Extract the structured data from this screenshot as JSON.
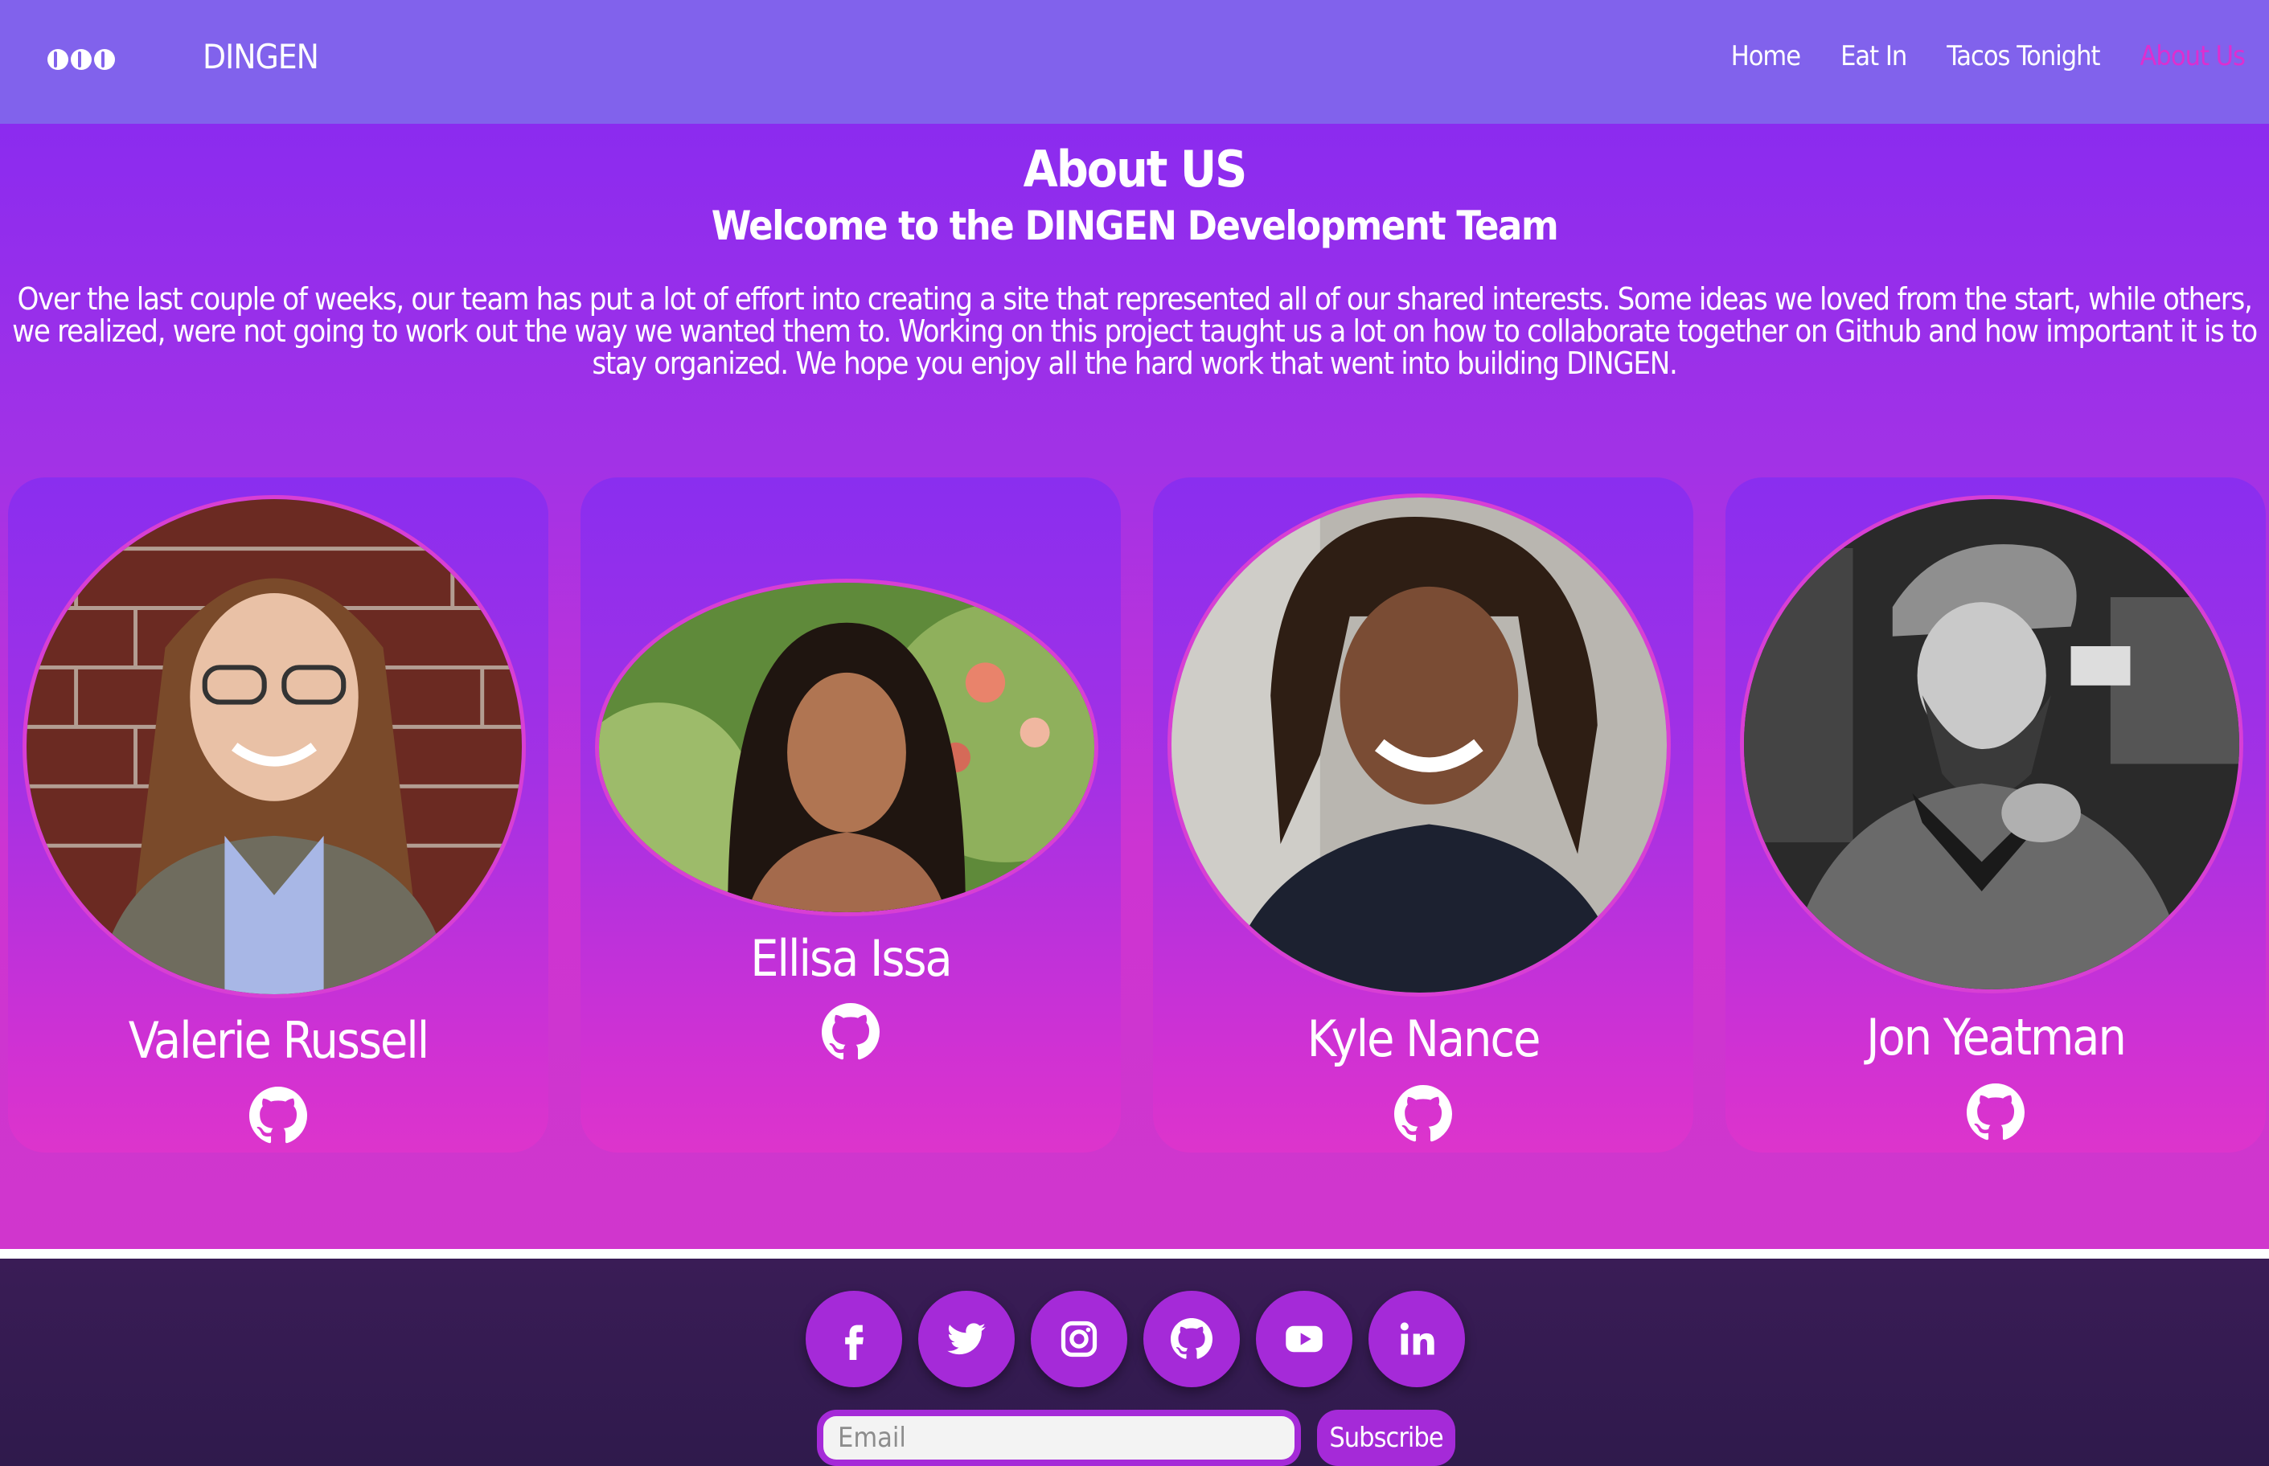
{
  "nav": {
    "brand": "DINGEN",
    "links": [
      "Home",
      "Eat In",
      "Tacos Tonight",
      "About Us"
    ],
    "active": "About Us"
  },
  "about": {
    "title": "About US",
    "subtitle": "Welcome to the DINGEN Development Team",
    "intro": "Over the last couple of weeks, our team has put a lot of effort into creating a site that represented all of our shared interests. Some ideas we loved from the start, while others, we realized, were not going to work out the way we wanted them to. Working on this project taught us a lot on how to collaborate together on Github and how important it is to stay organized. We hope you enjoy all the hard work that went into building DINGEN."
  },
  "team": [
    {
      "name": "Valerie Russell",
      "photo": "portrait"
    },
    {
      "name": "Ellisa Issa",
      "photo": "portrait"
    },
    {
      "name": "Kyle Nance",
      "photo": "portrait"
    },
    {
      "name": "Jon Yeatman",
      "photo": "portrait"
    }
  ],
  "footer": {
    "social": [
      "facebook-icon",
      "twitter-icon",
      "instagram-icon",
      "github-icon",
      "youtube-icon",
      "linkedin-icon"
    ],
    "email_placeholder": "Email",
    "subscribe_label": "Subscribe"
  },
  "colors": {
    "navbar": "#8162ec",
    "accent": "#a52ad8",
    "active_link": "#dd2ed0",
    "footer": "#35194f"
  }
}
